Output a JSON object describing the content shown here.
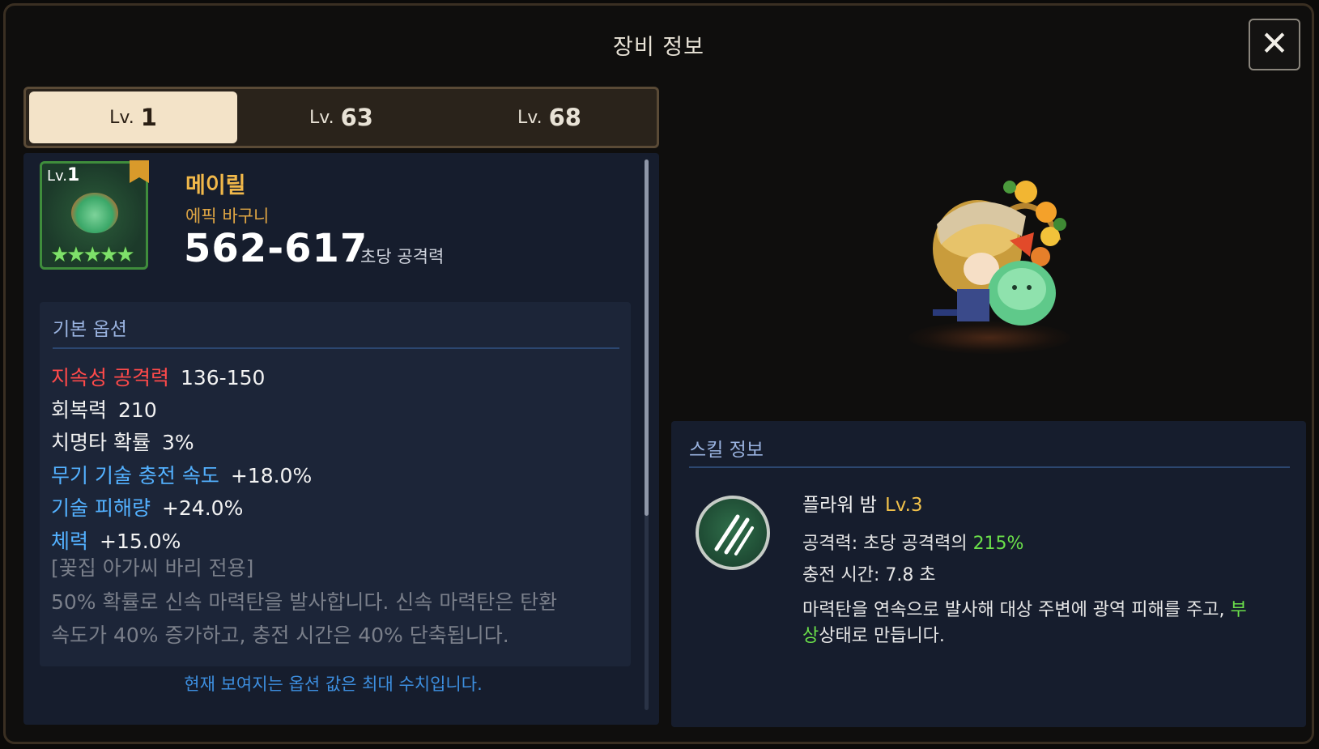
{
  "window": {
    "title": "장비 정보",
    "close_glyph": "✕"
  },
  "tabs": [
    {
      "prefix": "Lv.",
      "num": "1",
      "active": true
    },
    {
      "prefix": "Lv.",
      "num": "63",
      "active": false
    },
    {
      "prefix": "Lv.",
      "num": "68",
      "active": false
    }
  ],
  "item": {
    "icon_level_prefix": "Lv.",
    "icon_level": "1",
    "stars": "★★★★★",
    "star_count": 5,
    "name": "메이릴",
    "rarity": "에픽 바구니",
    "attack": "562-617",
    "attack_label": "초당 공격력"
  },
  "options": {
    "title": "기본 옵션",
    "rows": [
      {
        "key": "지속성 공격력",
        "value": "136-150",
        "color": "#ff4a4a"
      },
      {
        "key": "회복력",
        "value": "210",
        "color": "#f2f2f2"
      },
      {
        "key": "치명타 확률",
        "value": "3%",
        "color": "#f2f2f2"
      },
      {
        "key": "무기 기술 충전 속도",
        "value": "+18.0%",
        "color": "#53b1ff"
      },
      {
        "key": "기술 피해량",
        "value": "+24.0%",
        "color": "#53b1ff"
      },
      {
        "key": "체력",
        "value": "+15.0%",
        "color": "#53b1ff"
      }
    ],
    "exclusive_label": "[꽃집 아가씨 바리 전용]",
    "exclusive_desc_1": "50% 확률로 신속 마력탄을 발사합니다. 신속 마력탄은 탄환",
    "exclusive_desc_2": "속도가 40% 증가하고, 충전 시간은 40% 단축됩니다."
  },
  "footnote": "현재 보여지는 옵션 값은 최대 수치입니다.",
  "skill": {
    "section_title": "스킬 정보",
    "name": "플라워 밤",
    "level": "Lv.3",
    "attack_prefix": "공격력: 초당 공격력의",
    "attack_value": "215%",
    "charge": "충전 시간: 7.8 초",
    "desc_main": "마력탄을 연속으로 발사해 대상 주변에 광역 피해를 주고, ",
    "desc_highlight_1": "부",
    "desc_highlight_2": "상",
    "desc_end": "상태로 만듭니다."
  },
  "colors": {
    "accent_gold": "#f1b84a",
    "green_text": "#6be04a",
    "blue_option": "#53b1ff",
    "red_option": "#ff4a4a"
  }
}
